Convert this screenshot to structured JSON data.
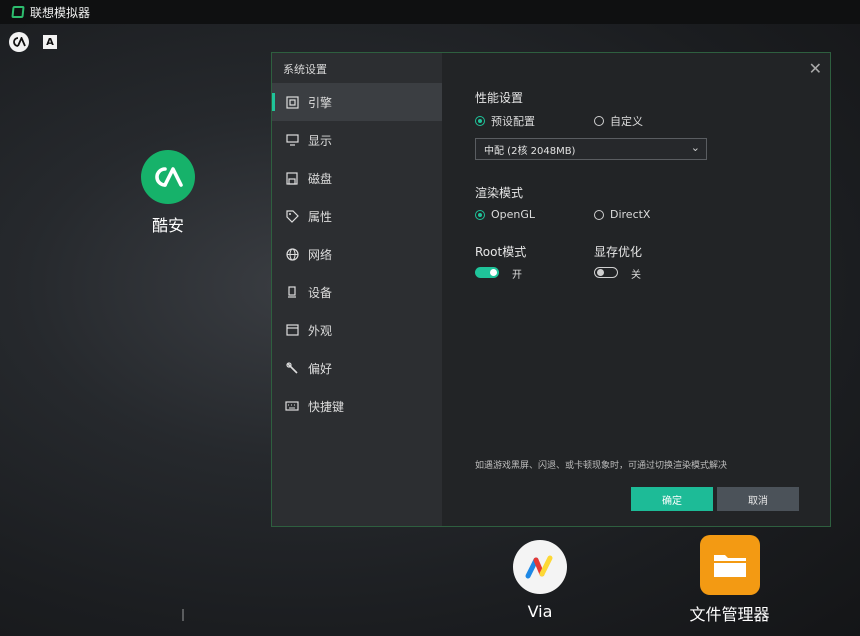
{
  "app": {
    "title": "联想模拟器"
  },
  "status_icons": {
    "coolapk": "coolapk-icon",
    "a": "A"
  },
  "desktop": {
    "apps": [
      {
        "label": "酷安",
        "icon": "coolapk-icon",
        "color": "#16b26a"
      },
      {
        "label": "Via",
        "icon": "via-icon",
        "color": "#f4f4f4"
      },
      {
        "label": "文件管理器",
        "icon": "folder-icon",
        "color": "#f39a13"
      }
    ]
  },
  "dialog": {
    "title": "系统设置",
    "close_icon": "close-icon",
    "nav": [
      {
        "label": "引擎",
        "icon": "chip-icon",
        "active": true
      },
      {
        "label": "显示",
        "icon": "monitor-icon",
        "active": false
      },
      {
        "label": "磁盘",
        "icon": "disk-icon",
        "active": false
      },
      {
        "label": "属性",
        "icon": "tag-icon",
        "active": false
      },
      {
        "label": "网络",
        "icon": "globe-icon",
        "active": false
      },
      {
        "label": "设备",
        "icon": "device-icon",
        "active": false
      },
      {
        "label": "外观",
        "icon": "window-icon",
        "active": false
      },
      {
        "label": "偏好",
        "icon": "wrench-icon",
        "active": false
      },
      {
        "label": "快捷键",
        "icon": "keyboard-icon",
        "active": false
      }
    ],
    "performance": {
      "title": "性能设置",
      "options": [
        "预设配置",
        "自定义"
      ],
      "selected": "预设配置",
      "preset_value": "中配 (2核 2048MB)"
    },
    "render": {
      "title": "渲染模式",
      "options": [
        "OpenGL",
        "DirectX"
      ],
      "selected": "OpenGL"
    },
    "root": {
      "title": "Root模式",
      "state_label": "开",
      "on": true
    },
    "memory": {
      "title": "显存优化",
      "state_label": "关",
      "on": false
    },
    "hint": "如遇游戏黑屏、闪退、或卡顿现象时，可通过切换渲染模式解决",
    "buttons": {
      "ok": "确定",
      "cancel": "取消"
    }
  },
  "colors": {
    "accent": "#1fc49a",
    "dialog_bg": "#222426",
    "sidebar_bg": "#2c2e31"
  }
}
